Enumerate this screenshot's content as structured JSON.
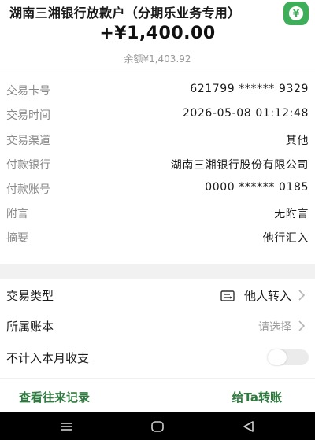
{
  "header": {
    "payer": "湖南三湘银行放款户（分期乐业务专用）",
    "badge_symbol": "¥",
    "amount": "+¥1,400.00",
    "balance": "余额¥1,403.92"
  },
  "details": [
    {
      "label": "交易卡号",
      "value": "621799 ****** 9329"
    },
    {
      "label": "交易时间",
      "value": "2026-05-08 01:12:48"
    },
    {
      "label": "交易渠道",
      "value": "其他"
    },
    {
      "label": "付款银行",
      "value": "湖南三湘银行股份有限公司"
    },
    {
      "label": "付款账号",
      "value": "0000 ****** 0185"
    },
    {
      "label": "附言",
      "value": "无附言"
    },
    {
      "label": "摘要",
      "value": "他行汇入"
    }
  ],
  "options": {
    "type": {
      "label": "交易类型",
      "value": "他人转入"
    },
    "account": {
      "label": "所属账本",
      "placeholder": "请选择"
    },
    "exclude": {
      "label": "不计入本月收支",
      "enabled": false
    }
  },
  "actions": {
    "history": "查看往来记录",
    "transfer": "给Ta转账"
  },
  "colors": {
    "accent": "#2f7a3f",
    "badge": "#3fae5a",
    "muted": "#999999",
    "nav": "#000000"
  },
  "icons": [
    "yen-icon",
    "transfer-type-icon",
    "chevron-right-icon",
    "toggle-switch",
    "menu-nav-icon",
    "home-nav-icon",
    "back-nav-icon"
  ]
}
